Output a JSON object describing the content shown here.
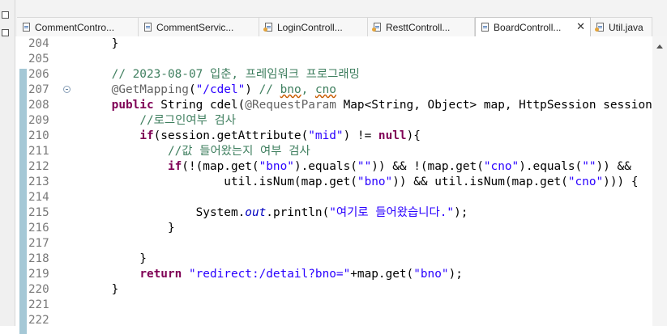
{
  "tabs": [
    {
      "label": "CommentContro...",
      "kind": "java",
      "active": false
    },
    {
      "label": "CommentServic...",
      "kind": "java",
      "active": false
    },
    {
      "label": "LoginControll...",
      "kind": "java-modified",
      "active": false
    },
    {
      "label": "ResttControll...",
      "kind": "java-modified",
      "active": false
    },
    {
      "label": "BoardControll...",
      "kind": "java",
      "active": true,
      "close": "✕"
    },
    {
      "label": "Util.java",
      "kind": "java-modified",
      "active": false
    }
  ],
  "editor": {
    "lines": [
      {
        "num": "204",
        "code": "    }"
      },
      {
        "num": "205",
        "code": ""
      },
      {
        "num": "206",
        "code": "    // 2023-08-07 입춘, 프레임워크 프로그래밍"
      },
      {
        "num": "207",
        "code": "    @GetMapping(\"/cdel\") // bno, cno"
      },
      {
        "num": "208",
        "code": "    public String cdel(@RequestParam Map<String, Object> map, HttpSession session) {"
      },
      {
        "num": "209",
        "code": "        //로그인여부 검사"
      },
      {
        "num": "210",
        "code": "        if(session.getAttribute(\"mid\") != null){"
      },
      {
        "num": "211",
        "code": "            //값 들어왔는지 여부 검사"
      },
      {
        "num": "212",
        "code": "            if(!(map.get(\"bno\").equals(\"\")) && !(map.get(\"cno\").equals(\"\")) &&"
      },
      {
        "num": "213",
        "code": "                    util.isNum(map.get(\"bno\")) && util.isNum(map.get(\"cno\"))) {"
      },
      {
        "num": "214",
        "code": ""
      },
      {
        "num": "215",
        "code": "                System.out.println(\"여기로 들어왔습니다.\");"
      },
      {
        "num": "216",
        "code": "            }"
      },
      {
        "num": "217",
        "code": ""
      },
      {
        "num": "218",
        "code": "        }"
      },
      {
        "num": "219",
        "code": "        return \"redirect:/detail?bno=\"+map.get(\"bno\");"
      },
      {
        "num": "220",
        "code": "    }"
      },
      {
        "num": "221",
        "code": ""
      },
      {
        "num": "222",
        "code": ""
      }
    ]
  },
  "colors": {
    "keyword": "#7f0055",
    "comment": "#3f7f5f",
    "string": "#2a00ff",
    "annotation": "#646464",
    "static_field": "#0000c0",
    "line_number": "#7a7a7a",
    "change_ruler": "#5b9bb5"
  },
  "icons": {
    "tab_icon": "java-file-icon",
    "tab_close": "close-icon",
    "fold": "collapse-fold-icon",
    "scroll_up": "scroll-up-arrow-icon"
  }
}
